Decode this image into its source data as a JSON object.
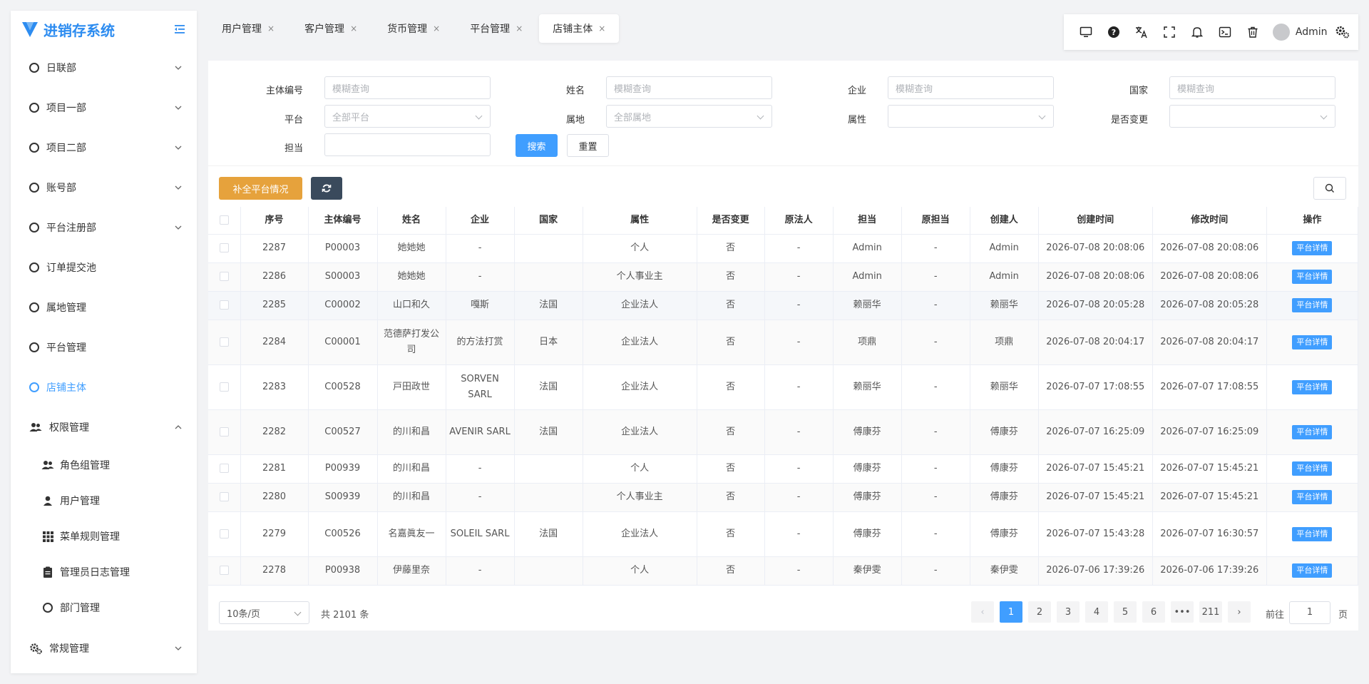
{
  "app": {
    "title": "进销存系统"
  },
  "sidebar": {
    "items": [
      {
        "label": "日联部",
        "expandable": true
      },
      {
        "label": "项目一部",
        "expandable": true
      },
      {
        "label": "项目二部",
        "expandable": true
      },
      {
        "label": "账号部",
        "expandable": true
      },
      {
        "label": "平台注册部",
        "expandable": true
      },
      {
        "label": "订单提交池",
        "expandable": false
      },
      {
        "label": "属地管理",
        "expandable": false
      },
      {
        "label": "平台管理",
        "expandable": false
      },
      {
        "label": "店铺主体",
        "expandable": false,
        "active": true
      }
    ],
    "permission": {
      "label": "权限管理",
      "children": [
        {
          "label": "角色组管理",
          "icon": "users-icon"
        },
        {
          "label": "用户管理",
          "icon": "user-icon"
        },
        {
          "label": "菜单规则管理",
          "icon": "grid-icon"
        },
        {
          "label": "管理员日志管理",
          "icon": "clipboard-icon"
        },
        {
          "label": "部门管理",
          "icon": "circle-icon"
        }
      ]
    },
    "general": {
      "label": "常规管理"
    }
  },
  "tabs": [
    {
      "label": "用户管理",
      "close": "×"
    },
    {
      "label": "客户管理",
      "close": "×"
    },
    {
      "label": "货币管理",
      "close": "×"
    },
    {
      "label": "平台管理",
      "close": "×"
    },
    {
      "label": "店铺主体",
      "close": "×",
      "active": true
    }
  ],
  "toolbar": {
    "icons": [
      "monitor-icon",
      "help-icon",
      "translate-icon",
      "fullscreen-icon",
      "bell-icon",
      "terminal-icon",
      "trash-icon"
    ],
    "user": "Admin"
  },
  "filter": {
    "entity_no": {
      "label": "主体编号",
      "placeholder": "模糊查询"
    },
    "name": {
      "label": "姓名",
      "placeholder": "模糊查询"
    },
    "company": {
      "label": "企业",
      "placeholder": "模糊查询"
    },
    "country": {
      "label": "国家",
      "placeholder": "模糊查询"
    },
    "platform": {
      "label": "平台",
      "value": "全部平台"
    },
    "territory": {
      "label": "属地",
      "value": "全部属地"
    },
    "attribute": {
      "label": "属性",
      "value": ""
    },
    "changed": {
      "label": "是否变更",
      "value": ""
    },
    "owner": {
      "label": "担当",
      "value": ""
    },
    "search_btn": "搜索",
    "reset_btn": "重置"
  },
  "actions": {
    "complete_btn": "补全平台情况"
  },
  "table": {
    "columns": [
      "序号",
      "主体编号",
      "姓名",
      "企业",
      "国家",
      "属性",
      "是否变更",
      "原法人",
      "担当",
      "原担当",
      "创建人",
      "创建时间",
      "修改时间",
      "操作"
    ],
    "detail_label": "平台详情",
    "rows": [
      [
        "2287",
        "P00003",
        "她她她",
        "-",
        "",
        "个人",
        "否",
        "-",
        "Admin",
        "-",
        "Admin",
        "2026-07-08 20:08:06",
        "2026-07-08 20:08:06"
      ],
      [
        "2286",
        "S00003",
        "她她她",
        "-",
        "",
        "个人事业主",
        "否",
        "-",
        "Admin",
        "-",
        "Admin",
        "2026-07-08 20:08:06",
        "2026-07-08 20:08:06"
      ],
      [
        "2285",
        "C00002",
        "山口和久",
        "嘎斯",
        "法国",
        "企业法人",
        "否",
        "-",
        "赖丽华",
        "-",
        "赖丽华",
        "2026-07-08 20:05:28",
        "2026-07-08 20:05:28"
      ],
      [
        "2284",
        "C00001",
        "范德萨打发公司",
        "的方法打赏",
        "日本",
        "企业法人",
        "否",
        "-",
        "项鼎",
        "-",
        "项鼎",
        "2026-07-08 20:04:17",
        "2026-07-08 20:04:17"
      ],
      [
        "2283",
        "C00528",
        "戸田政世",
        "SORVEN SARL",
        "法国",
        "企业法人",
        "否",
        "-",
        "赖丽华",
        "-",
        "赖丽华",
        "2026-07-07 17:08:55",
        "2026-07-07 17:08:55"
      ],
      [
        "2282",
        "C00527",
        "的川和昌",
        "AVENIR SARL",
        "法国",
        "企业法人",
        "否",
        "-",
        "傅康芬",
        "-",
        "傅康芬",
        "2026-07-07 16:25:09",
        "2026-07-07 16:25:09"
      ],
      [
        "2281",
        "P00939",
        "的川和昌",
        "-",
        "",
        "个人",
        "否",
        "-",
        "傅康芬",
        "-",
        "傅康芬",
        "2026-07-07 15:45:21",
        "2026-07-07 15:45:21"
      ],
      [
        "2280",
        "S00939",
        "的川和昌",
        "-",
        "",
        "个人事业主",
        "否",
        "-",
        "傅康芬",
        "-",
        "傅康芬",
        "2026-07-07 15:45:21",
        "2026-07-07 15:45:21"
      ],
      [
        "2279",
        "C00526",
        "名嘉眞友一",
        "SOLEIL SARL",
        "法国",
        "企业法人",
        "否",
        "-",
        "傅康芬",
        "-",
        "傅康芬",
        "2026-07-07 15:43:28",
        "2026-07-07 16:30:57"
      ],
      [
        "2278",
        "P00938",
        "伊藤里奈",
        "-",
        "",
        "个人",
        "否",
        "-",
        "秦伊雯",
        "-",
        "秦伊雯",
        "2026-07-06 17:39:26",
        "2026-07-06 17:39:26"
      ]
    ]
  },
  "pagination": {
    "page_size": "10条/页",
    "total": "共 2101 条",
    "pages": [
      "1",
      "2",
      "3",
      "4",
      "5",
      "6",
      "•••",
      "211"
    ],
    "current": "1",
    "goto_label": "前往",
    "goto_value": "1",
    "goto_suffix": "页"
  },
  "colors": {
    "primary": "#409eff",
    "warning": "#e6a23c",
    "dark": "#3a4a5c"
  }
}
